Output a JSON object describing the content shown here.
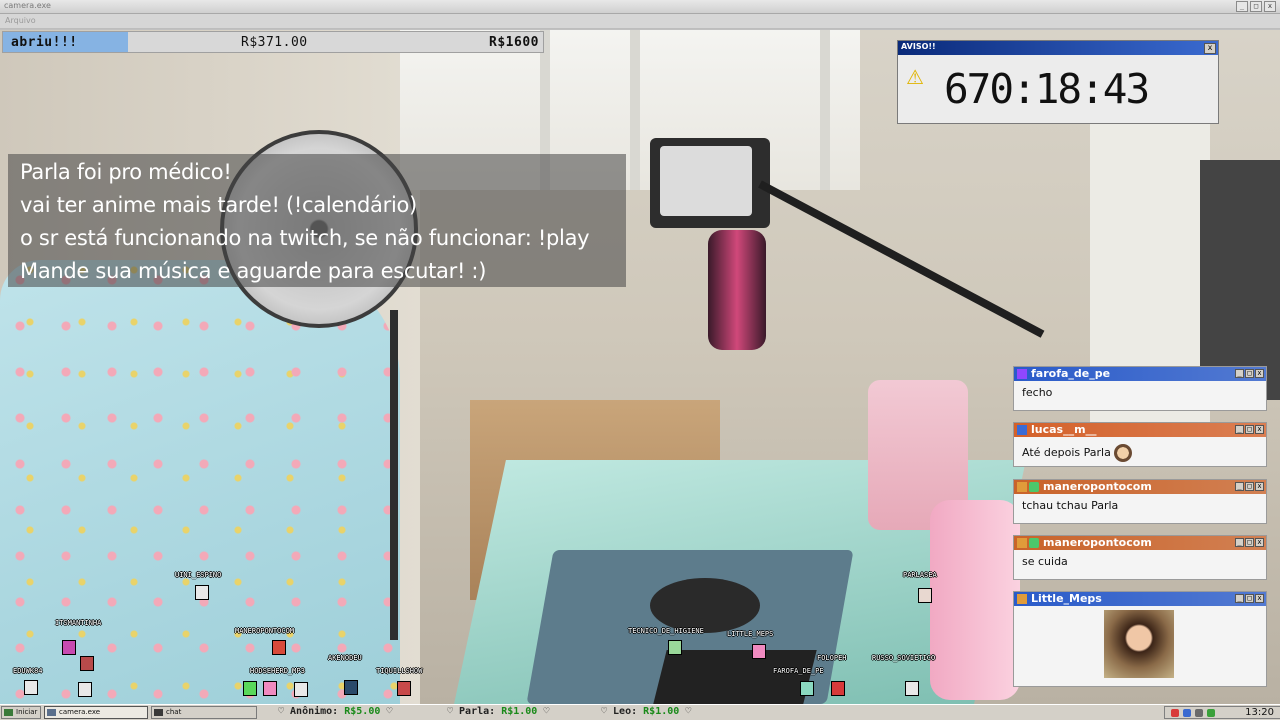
{
  "window": {
    "title": "camera.exe",
    "menu_label": "Arquivo",
    "controls": [
      "_",
      "□",
      "x"
    ]
  },
  "goal": {
    "label": "abriu!!!",
    "current": "R$371.00",
    "target": "R$1600",
    "progress": 0.232,
    "fill_color": "#86b3e3"
  },
  "overlay": {
    "lines": [
      "Parla foi pro médico!",
      "vai ter anime mais tarde! (!calendário)",
      "o sr está funcionando na twitch, se não funcionar: !play",
      "Mande sua música e aguarde para escutar! :)"
    ]
  },
  "timer": {
    "title": "AVISO!!",
    "close": "x",
    "icon": "warning-icon",
    "warn_glyph": "⚠",
    "time": "670:18:43"
  },
  "chats": [
    {
      "user": "farofa_de_pe",
      "message": "fecho",
      "color": "#2a5bc9",
      "badge_color": "#9147ff"
    },
    {
      "user": "lucas__m__",
      "message": "Até depois Parla",
      "color": "#d4612a",
      "badge_color": "#3a6bd6",
      "has_emote": true
    },
    {
      "user": "maneropontocom",
      "message": "tchau tchau Parla",
      "color": "#c9632a",
      "badge_color": "#e09b3a"
    },
    {
      "user": "maneropontocom",
      "message": "se cuida",
      "color": "#c9632a",
      "badge_color": "#e09b3a"
    },
    {
      "user": "Little_Meps",
      "message": "",
      "color": "#2a5bc9",
      "badge_color": "#e09b3a",
      "has_cam": true
    }
  ],
  "floor_avatars": [
    {
      "name": "UINI_ESPINO"
    },
    {
      "name": "ITSMANTINHA"
    },
    {
      "name": "MANEROPONTOCOM"
    },
    {
      "name": "TECNICO_DE_HIGIENE"
    },
    {
      "name": "LITTLE_MEPS"
    },
    {
      "name": "PARLASEA"
    },
    {
      "name": "EDUWK84"
    },
    {
      "name": "HODSEHERD_MP3"
    },
    {
      "name": "AKENODEU"
    },
    {
      "name": "TIQUILLSHOW"
    },
    {
      "name": "FAROFA_DE_PE"
    },
    {
      "name": "FOLOPEH"
    },
    {
      "name": "RUSSO_SOVIETICO"
    }
  ],
  "taskbar": {
    "start_label": "Iniciar",
    "task_camera": "camera.exe",
    "task_chat": "chat",
    "donations": [
      {
        "name": "♡ Anônimo: ",
        "amount": "R$5.00",
        "end": " ♡"
      },
      {
        "name": "♡ Parla: ",
        "amount": "R$1.00",
        "end": " ♡"
      },
      {
        "name": "♡ Leo: ",
        "amount": "R$1.00",
        "end": " ♡"
      }
    ],
    "clock": "13:20"
  }
}
